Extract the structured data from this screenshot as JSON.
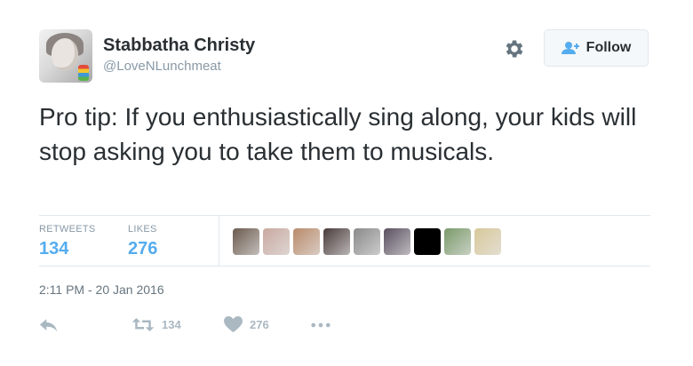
{
  "author": {
    "name": "Stabbatha Christy",
    "handle": "@LoveNLunchmeat"
  },
  "header": {
    "follow_label": "Follow"
  },
  "tweet": {
    "text": "Pro tip: If you enthusiastically sing along, your kids will stop asking you to take them to musicals."
  },
  "stats": {
    "retweets_label": "RETWEETS",
    "retweets": "134",
    "likes_label": "LIKES",
    "likes": "276"
  },
  "likers": [
    {
      "icon": "liker-avatar-1",
      "color": "#6b5a4e"
    },
    {
      "icon": "liker-avatar-2",
      "color": "#c9a9a0"
    },
    {
      "icon": "liker-avatar-3",
      "color": "#b98a6a"
    },
    {
      "icon": "liker-avatar-4",
      "color": "#4a3b3b"
    },
    {
      "icon": "liker-avatar-5",
      "color": "#8a8a8a"
    },
    {
      "icon": "liker-avatar-6",
      "color": "#5a5060"
    },
    {
      "icon": "liker-avatar-7",
      "color": "#000000"
    },
    {
      "icon": "liker-avatar-8",
      "color": "#7a9a6a"
    },
    {
      "icon": "liker-avatar-9",
      "color": "#d8c89a"
    }
  ],
  "timestamp": "2:11 PM - 20 Jan 2016",
  "actions": {
    "retweet_count": "134",
    "like_count": "276"
  },
  "colors": {
    "accent": "#55acee",
    "text": "#292f33",
    "muted": "#8899a6",
    "border": "#e1e8ed"
  }
}
